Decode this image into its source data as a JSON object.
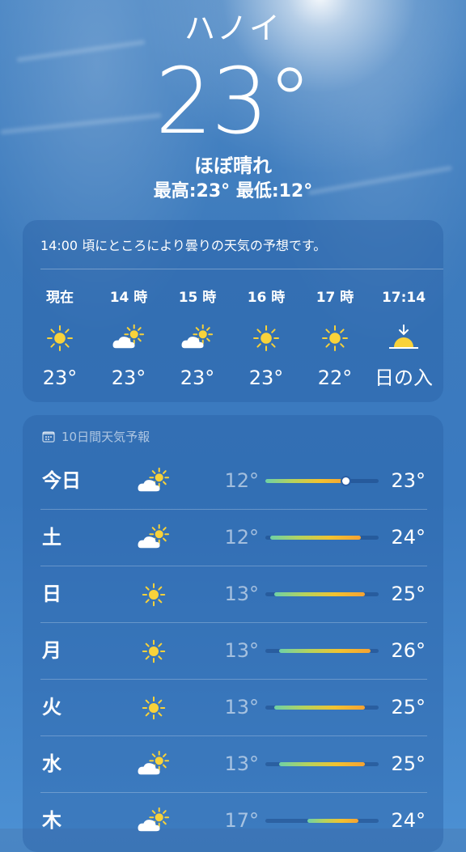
{
  "location": {
    "city": "ハノイ",
    "temperature": "23°",
    "condition": "ほぼ晴れ",
    "high_low": "最高:23°  最低:12°"
  },
  "hourly": {
    "summary": "14:00 頃にところにより曇りの天気の予想です。",
    "items": [
      {
        "label": "現在",
        "icon": "sun-icon",
        "temp": "23°"
      },
      {
        "label": "14 時",
        "icon": "partly-cloudy-icon",
        "temp": "23°"
      },
      {
        "label": "15 時",
        "icon": "partly-cloudy-icon",
        "temp": "23°"
      },
      {
        "label": "16 時",
        "icon": "sun-icon",
        "temp": "23°"
      },
      {
        "label": "17 時",
        "icon": "sun-icon",
        "temp": "22°"
      },
      {
        "label": "17:14",
        "icon": "sunset-icon",
        "temp": "日の入"
      }
    ]
  },
  "daily": {
    "title": "10日間天気予報",
    "title_icon": "calendar-icon",
    "days": [
      {
        "day": "今日",
        "icon": "partly-cloudy-icon",
        "low": "12°",
        "high": "23°",
        "bar_start": 0.0,
        "bar_end": 0.72,
        "current_marker": 0.71
      },
      {
        "day": "土",
        "icon": "partly-cloudy-icon",
        "low": "12°",
        "high": "24°",
        "bar_start": 0.04,
        "bar_end": 0.84
      },
      {
        "day": "日",
        "icon": "sun-icon",
        "low": "13°",
        "high": "25°",
        "bar_start": 0.08,
        "bar_end": 0.88
      },
      {
        "day": "月",
        "icon": "sun-icon",
        "low": "13°",
        "high": "26°",
        "bar_start": 0.12,
        "bar_end": 0.93
      },
      {
        "day": "火",
        "icon": "sun-icon",
        "low": "13°",
        "high": "25°",
        "bar_start": 0.08,
        "bar_end": 0.88
      },
      {
        "day": "水",
        "icon": "partly-cloudy-icon",
        "low": "13°",
        "high": "25°",
        "bar_start": 0.12,
        "bar_end": 0.88
      },
      {
        "day": "木",
        "icon": "partly-cloudy-icon",
        "low": "17°",
        "high": "24°",
        "bar_start": 0.37,
        "bar_end": 0.82
      }
    ]
  },
  "colors": {
    "sun": "#f8d23a",
    "background": "#3d7bbd"
  }
}
